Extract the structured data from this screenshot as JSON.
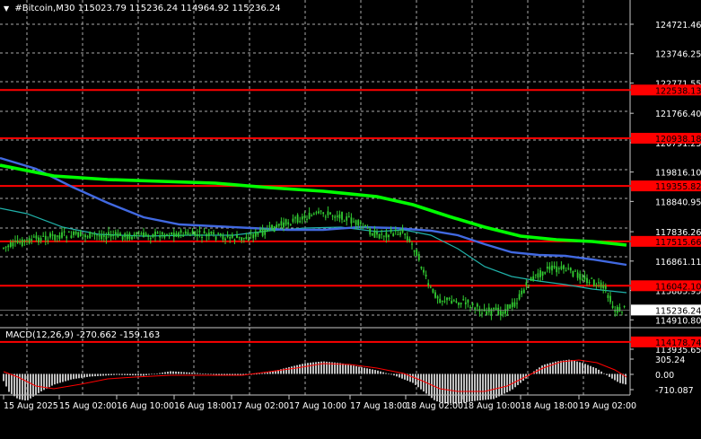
{
  "header": {
    "arrow": "▼",
    "symbol": "#Bitcoin,M30",
    "ohlc": "115023.79 115236.24 114964.92 115236.24"
  },
  "price_axis": {
    "ticks": [
      "124721.46",
      "123746.25",
      "122771.55",
      "121766.40",
      "120791.25",
      "119816.10",
      "118840.95",
      "117836.26",
      "116861.11",
      "115885.95",
      "114910.80",
      "113935.65"
    ],
    "current_price": "115236.24"
  },
  "levels": [
    "122538.13",
    "120938.18",
    "119355.82",
    "117515.66",
    "116042.10",
    "114178.74"
  ],
  "macd": {
    "label": "MACD(12,26,9) -270.662 -159.163",
    "ticks": [
      "305.24",
      "0.00",
      "-710.087"
    ]
  },
  "time_axis": [
    "15 Aug 2025",
    "15 Aug 02:00",
    "16 Aug 10:00",
    "16 Aug 18:00",
    "17 Aug 02:00",
    "17 Aug 10:00",
    "17 Aug 18:00",
    "18 Aug 02:00",
    "18 Aug 10:00",
    "18 Aug 18:00",
    "19 Aug 02:00"
  ],
  "colors": {
    "background": "#000000",
    "grid": "#c8c8c8",
    "level_line": "#ff0000",
    "level_label_bg": "#ff0000",
    "candle": "#32cd32",
    "ma_slow": "#00ff00",
    "ma_mid": "#4169e1",
    "ma_fast": "#20b2aa",
    "macd_hist": "#c0c0c0",
    "macd_signal": "#ff0000",
    "price_label_bg": "#ffffff"
  }
}
